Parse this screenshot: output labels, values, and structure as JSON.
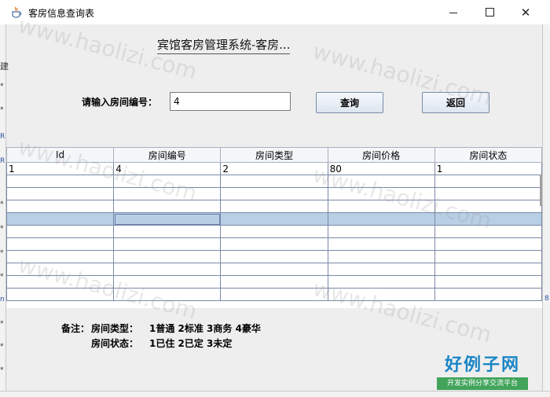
{
  "window": {
    "title": "客房信息查询表",
    "icon": "java-cup-icon",
    "controls": {
      "minimize_glyph": "",
      "maximize_glyph": "",
      "close_glyph": "✕"
    }
  },
  "header": {
    "system_title": "宾馆客房管理系统-客房..."
  },
  "search": {
    "label": "请输入房间编号：",
    "value": "4",
    "query_button": "查询",
    "back_button": "返回"
  },
  "table": {
    "columns": [
      "Id",
      "房间编号",
      "房间类型",
      "房间价格",
      "房间状态"
    ],
    "rows": [
      [
        "1",
        "4",
        "2",
        "80",
        "1"
      ],
      [
        "",
        "",
        "",
        "",
        ""
      ],
      [
        "",
        "",
        "",
        "",
        ""
      ],
      [
        "",
        "",
        "",
        "",
        ""
      ],
      [
        "",
        "",
        "",
        "",
        ""
      ],
      [
        "",
        "",
        "",
        "",
        ""
      ],
      [
        "",
        "",
        "",
        "",
        ""
      ],
      [
        "",
        "",
        "",
        "",
        ""
      ],
      [
        "",
        "",
        "",
        "",
        ""
      ],
      [
        "",
        "",
        "",
        "",
        ""
      ],
      [
        "",
        "",
        "",
        "",
        ""
      ]
    ],
    "selected_row": 4,
    "focused_cell": {
      "row": 4,
      "col": 1
    }
  },
  "remark": {
    "label": "备注：",
    "type_label": "房间类型：",
    "type_values": "1普通 2标准 3商务 4豪华",
    "status_label": "房间状态：",
    "status_values": "1已住 2已定 3未定"
  },
  "left_edge_glyphs": [
    "建",
    "*",
    "*",
    "R",
    "R",
    "*",
    "*",
    "*",
    "*",
    "n",
    "*",
    "*",
    "*"
  ],
  "right_edge_glyphs": [
    "8"
  ],
  "watermark": {
    "text": "www.haolizi.com"
  },
  "brand": {
    "name": "好例子网",
    "tagline": "开发实例分享交流平台"
  },
  "colors": {
    "window_bg": "#eeeeee",
    "table_grid": "#7a8aa6",
    "selected_row": "#b8cfe5",
    "button_border": "#7a8ca8",
    "brand_blue": "#1a86c6",
    "brand_green": "#41a45a"
  }
}
